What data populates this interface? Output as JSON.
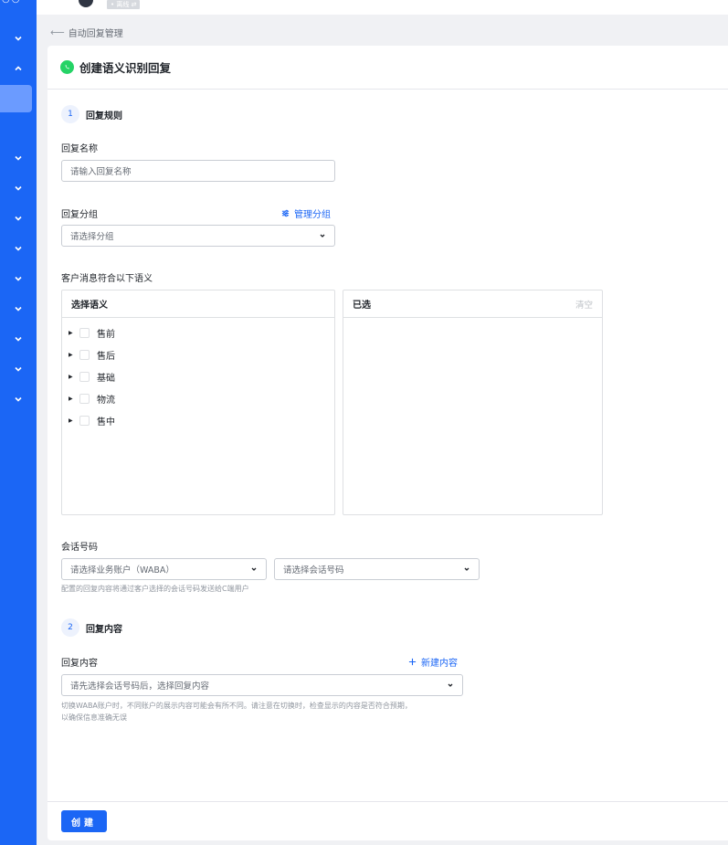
{
  "topbar": {
    "status_chip": "• 离线 ⇄"
  },
  "breadcrumb": {
    "label": "自动回复管理"
  },
  "page": {
    "title": "创建语义识别回复"
  },
  "step1": {
    "num": "1",
    "title": "回复规则"
  },
  "reply_name": {
    "label": "回复名称",
    "placeholder": "请输入回复名称"
  },
  "reply_group": {
    "label": "回复分组",
    "manage_label": "管理分组",
    "placeholder": "请选择分组"
  },
  "semantic": {
    "label": "客户消息符合以下语义",
    "left_title": "选择语义",
    "right_title": "已选",
    "clear_label": "清空",
    "items": [
      {
        "label": "售前"
      },
      {
        "label": "售后"
      },
      {
        "label": "基础"
      },
      {
        "label": "物流"
      },
      {
        "label": "售中"
      }
    ]
  },
  "session_number": {
    "label": "会话号码",
    "waba_placeholder": "请选择业务账户（WABA）",
    "number_placeholder": "请选择会话号码",
    "help": "配置的回复内容将通过客户选择的会话号码发送给C端用户"
  },
  "step2": {
    "num": "2",
    "title": "回复内容"
  },
  "reply_content": {
    "label": "回复内容",
    "new_label": "新建内容",
    "placeholder": "请先选择会话号码后，选择回复内容",
    "help_line1": "切换WABA账户时，不同账户的展示内容可能会有所不同。请注意在切换时，检查显示的内容是否符合预期，",
    "help_line2": "以确保信息准确无误"
  },
  "footer": {
    "create_label": "创建"
  },
  "colors": {
    "primary": "#1b66f5",
    "whatsapp": "#25d366",
    "sidebar_active": "#6b9bff"
  },
  "icons": [
    "chevron-down-icon",
    "chevron-up-icon",
    "back-arrow-icon",
    "whatsapp-icon",
    "sliders-icon",
    "plus-icon",
    "caret-right-icon"
  ]
}
